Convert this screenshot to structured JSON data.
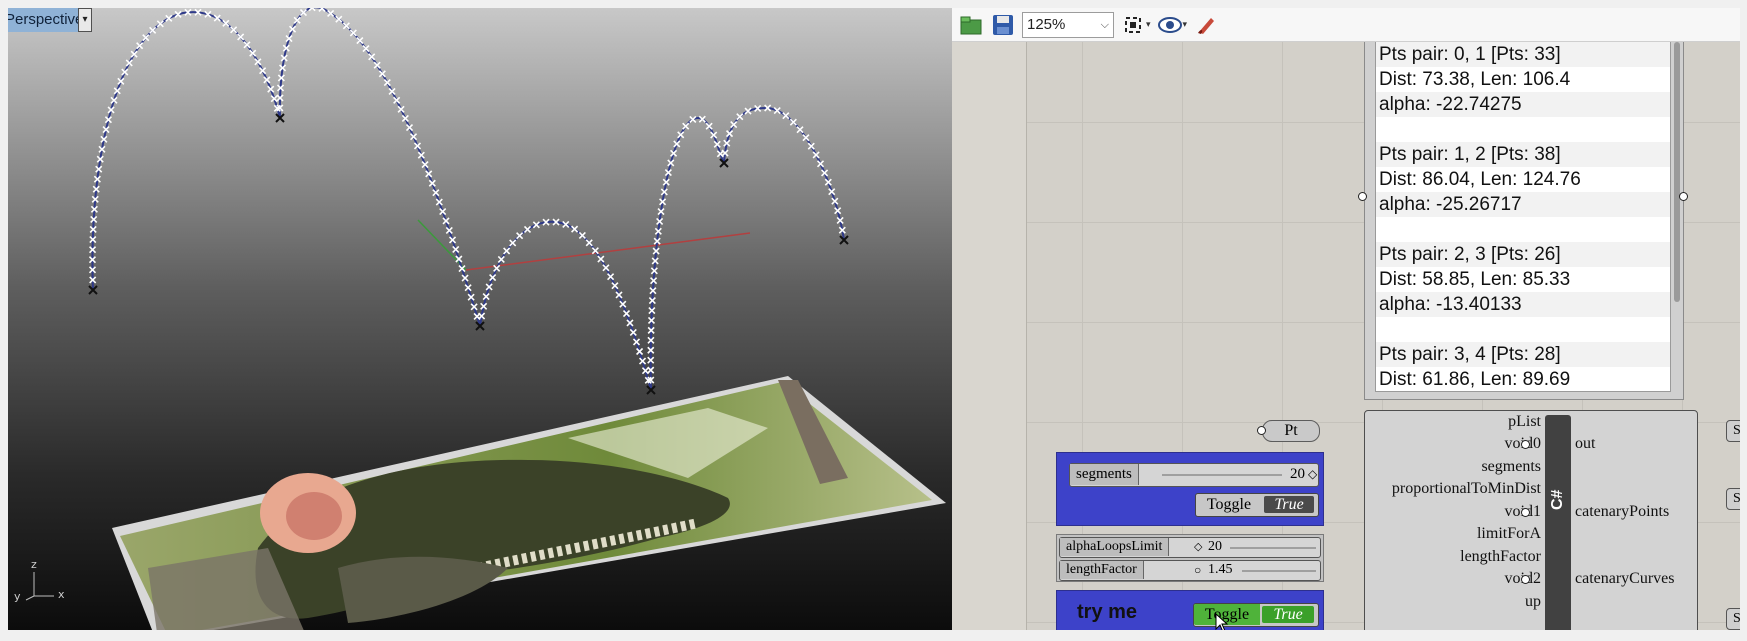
{
  "viewport": {
    "title": "Perspective",
    "menu_caret": "▾",
    "axis_labels": {
      "z": "z",
      "y": "y",
      "x": "x"
    }
  },
  "grasshopper": {
    "toolbar": {
      "zoom_value": "125%",
      "zoom_caret": "⌵",
      "caret": "▾",
      "icons": [
        "open-folder-icon",
        "save-icon",
        "zoom-extents-icon",
        "preview-eye-icon",
        "sketch-brush-icon"
      ]
    },
    "panel": {
      "lines": [
        "Pts pair: 0, 1 [Pts: 33]",
        "Dist: 73.38, Len: 106.4",
        "alpha: -22.74275",
        "",
        "Pts pair: 1, 2 [Pts: 38]",
        "Dist: 86.04, Len: 124.76",
        "alpha: -25.26717",
        "",
        "Pts pair: 2, 3 [Pts: 26]",
        "Dist: 58.85, Len: 85.33",
        "alpha: -13.40133",
        "",
        "Pts pair: 3, 4 [Pts: 28]",
        "Dist: 61.86, Len: 89.69"
      ]
    },
    "pt_param": "Pt",
    "segments_slider": {
      "label": "segments",
      "value": "20",
      "marker": "◇"
    },
    "toggle1": {
      "label": "Toggle",
      "state": "True"
    },
    "alpha_slider": {
      "label": "alphaLoopsLimit",
      "value": "20",
      "marker": "◇"
    },
    "length_slider": {
      "label": "lengthFactor",
      "value": "1.45",
      "marker": "○"
    },
    "try_group": {
      "label": "try me"
    },
    "toggle2": {
      "label": "Toggle",
      "state": "True"
    },
    "cs_component": {
      "title": "C#",
      "inputs": [
        "pList",
        "void0",
        "segments",
        "proportionalToMinDist",
        "void1",
        "limitForA",
        "lengthFactor",
        "void2",
        "up"
      ],
      "outputs": [
        "out",
        "catenaryPoints",
        "catenaryCurves"
      ]
    },
    "edge_tabs": [
      "S",
      "S",
      "S"
    ]
  }
}
